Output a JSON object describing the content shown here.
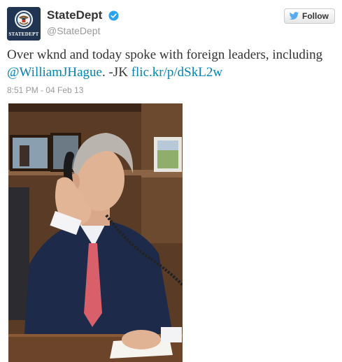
{
  "tweet": {
    "display_name": "StateDept",
    "screen_name": "@StateDept",
    "avatar_text": "STATEDEPT",
    "follow_label": "Follow",
    "text_lead": "Over wknd and today spoke with foreign leaders, including ",
    "mention": "@WilliamJHague",
    "text_mid": ". -JK ",
    "link": "flic.kr/p/dSkL2w",
    "timestamp": "8:51 PM - 04 Feb 13"
  },
  "icons": {
    "verified": "verified-badge-icon",
    "follow_bird": "twitter-bird-icon",
    "seal": "department-seal-icon"
  },
  "colors": {
    "link": "#0084b4",
    "verified": "#2aa3ef",
    "bird": "#55acee",
    "avatar_bg": "#1f3552"
  }
}
